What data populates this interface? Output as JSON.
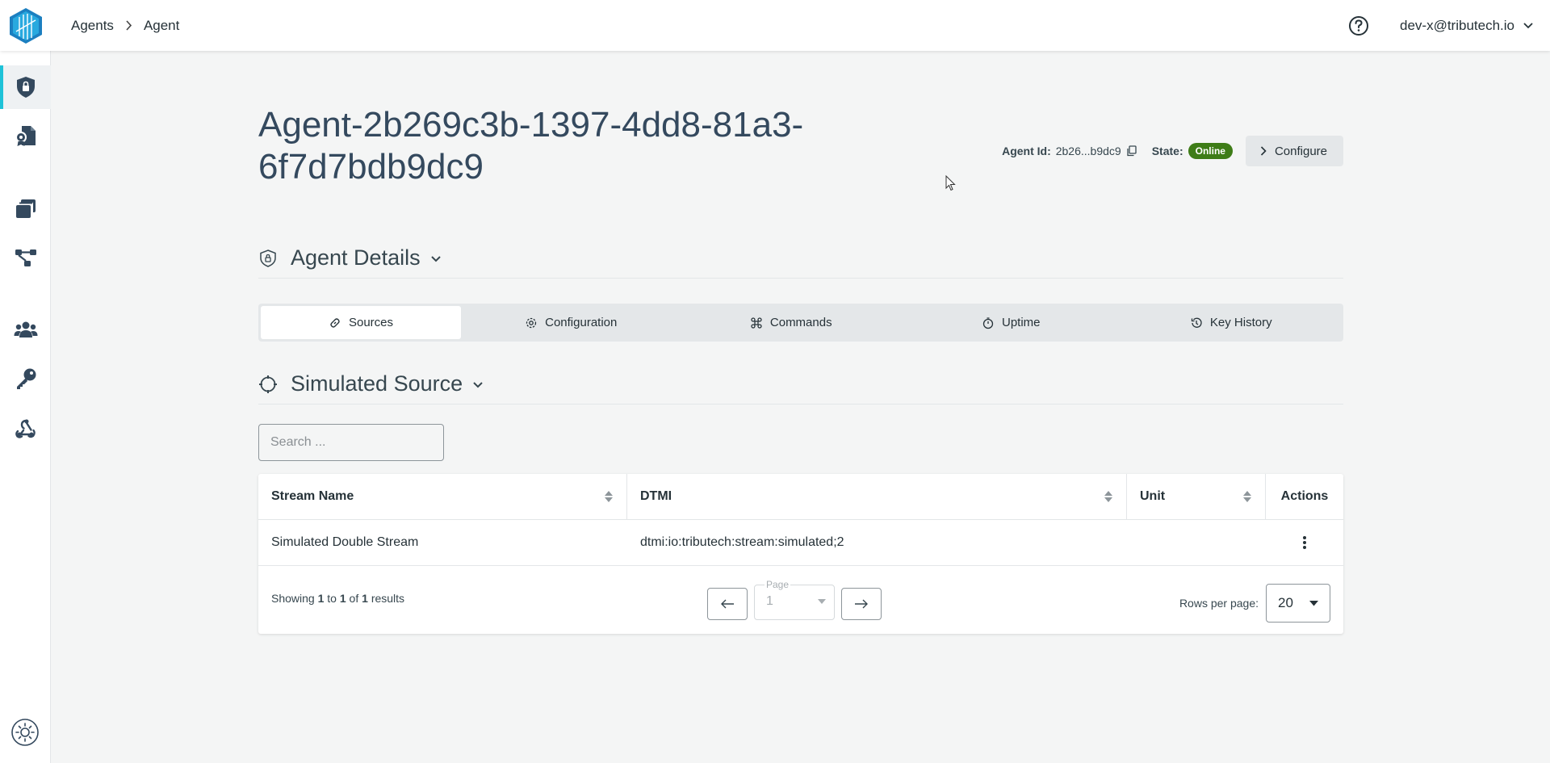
{
  "header": {
    "breadcrumb": [
      "Agents",
      "Agent"
    ],
    "user": "dev-x@tributech.io"
  },
  "sidebar": {
    "items": [
      {
        "icon": "shield-lock-icon",
        "active": true
      },
      {
        "icon": "certificate-file-icon",
        "active": false
      },
      {
        "icon": "stack-cards-icon",
        "active": false
      },
      {
        "icon": "node-graph-icon",
        "active": false
      },
      {
        "icon": "users-icon",
        "active": false
      },
      {
        "icon": "key-icon",
        "active": false
      },
      {
        "icon": "webhook-icon",
        "active": false
      }
    ],
    "theme_icon": "sun-icon"
  },
  "page": {
    "title": "Agent-2b269c3b-1397-4dd8-81a3-6f7d7bdb9dc9",
    "agent_id_label": "Agent Id:",
    "agent_id_value": "2b26...b9dc9",
    "state_label": "State:",
    "state_value": "Online",
    "configure_label": "Configure"
  },
  "agent_details": {
    "title": "Agent Details",
    "tabs": [
      {
        "label": "Sources",
        "icon": "link-icon",
        "active": true
      },
      {
        "label": "Configuration",
        "icon": "gear-icon",
        "active": false
      },
      {
        "label": "Commands",
        "icon": "command-icon",
        "active": false
      },
      {
        "label": "Uptime",
        "icon": "stopwatch-icon",
        "active": false
      },
      {
        "label": "Key History",
        "icon": "history-icon",
        "active": false
      }
    ]
  },
  "source": {
    "title": "Simulated Source",
    "search_placeholder": "Search ...",
    "columns": [
      "Stream Name",
      "DTMI",
      "Unit",
      "Actions"
    ],
    "rows": [
      {
        "stream_name": "Simulated Double Stream",
        "dtmi": "dtmi:io:tributech:stream:simulated;2",
        "unit": ""
      }
    ],
    "footer": {
      "showing": "Showing",
      "from": "1",
      "to_word": "to",
      "to": "1",
      "of_word": "of",
      "total": "1",
      "results_word": "results",
      "page_label": "Page",
      "page_value": "1",
      "rows_per_page_label": "Rows per page:",
      "rows_per_page_value": "20"
    }
  },
  "colors": {
    "accent": "#1ec2d8",
    "online_badge": "#3e7c17",
    "title": "#34495e"
  }
}
